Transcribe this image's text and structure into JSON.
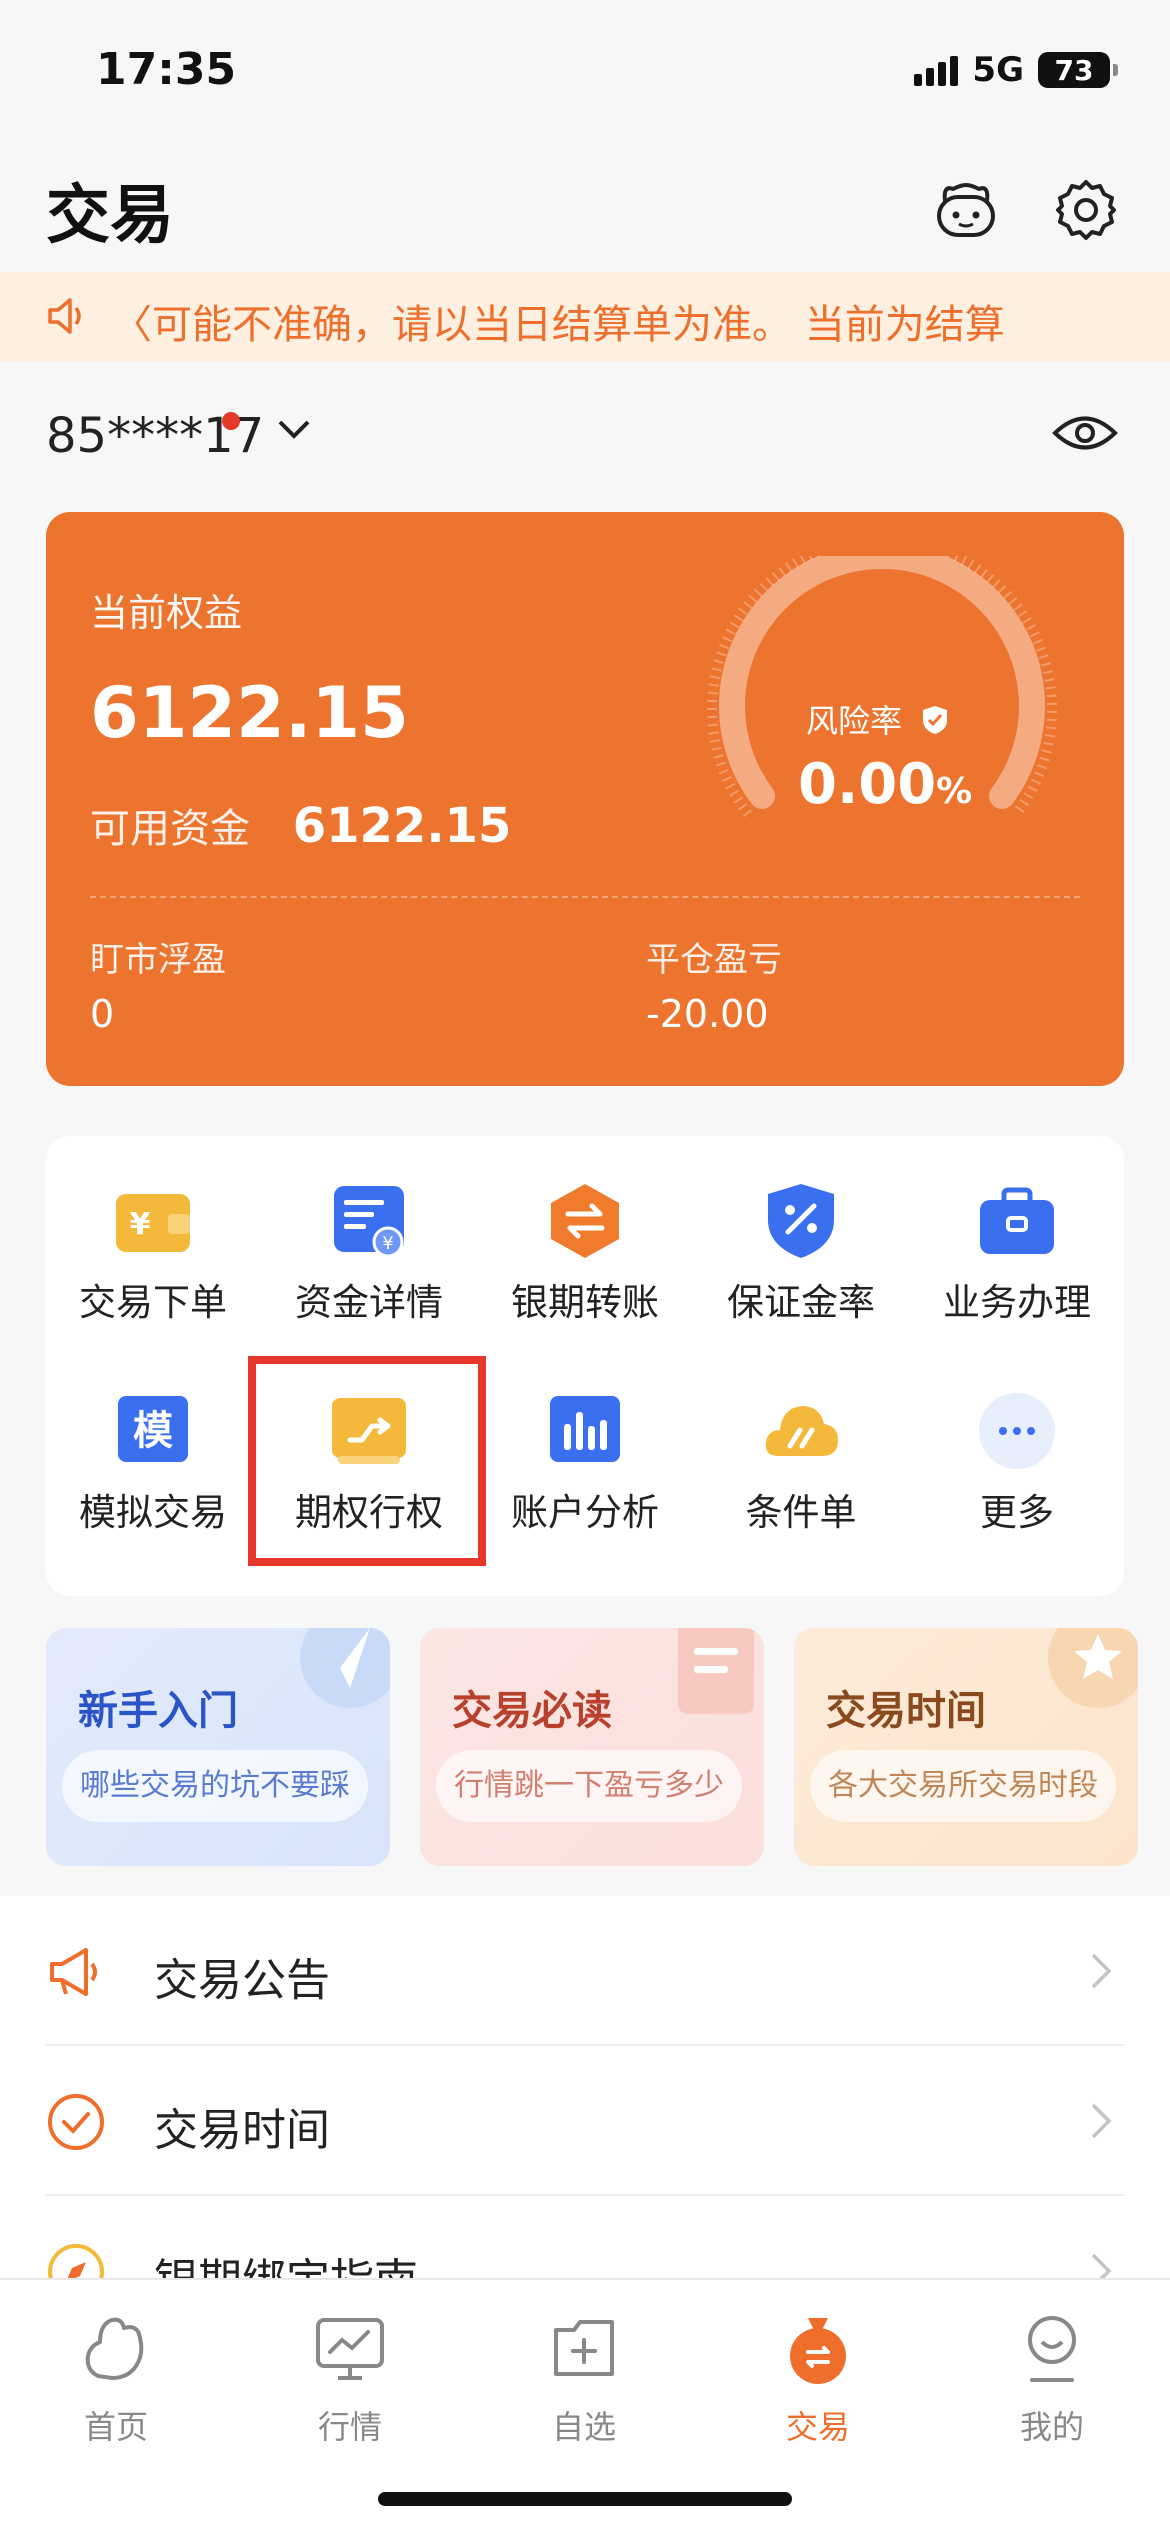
{
  "status_bar": {
    "time": "17:35",
    "network": "5G",
    "battery": "73"
  },
  "header": {
    "title": "交易"
  },
  "notice": {
    "text": "〈可能不准确，请以当日结算单为准。        当前为结算"
  },
  "account": {
    "number": "85****17"
  },
  "equity_card": {
    "equity_label": "当前权益",
    "equity_value": "6122.15",
    "available_label": "可用资金",
    "available_value": "6122.15",
    "risk_label": "风险率",
    "risk_value": "0.00",
    "risk_unit": "%",
    "floating_label": "盯市浮盈",
    "floating_value": "0",
    "closing_label": "平仓盈亏",
    "closing_value": "-20.00"
  },
  "grid": [
    {
      "label": "交易下单",
      "icon": "wallet-icon",
      "color": "#f4b83a"
    },
    {
      "label": "资金详情",
      "icon": "fund-detail-icon",
      "color": "#3a6ff0"
    },
    {
      "label": "银期转账",
      "icon": "transfer-icon",
      "color": "#f07b2c"
    },
    {
      "label": "保证金率",
      "icon": "margin-shield-icon",
      "color": "#3a6ff0"
    },
    {
      "label": "业务办理",
      "icon": "briefcase-icon",
      "color": "#3a6ff0"
    },
    {
      "label": "模拟交易",
      "icon": "simulate-icon",
      "glyph": "模",
      "color": "#3a6ff0"
    },
    {
      "label": "期权行权",
      "icon": "option-exercise-icon",
      "color": "#f4b83a"
    },
    {
      "label": "账户分析",
      "icon": "bar-chart-icon",
      "color": "#3a6ff0"
    },
    {
      "label": "条件单",
      "icon": "condition-order-icon",
      "color": "#f4b83a"
    },
    {
      "label": "更多",
      "icon": "more-icon",
      "color": "#3a6ff0"
    }
  ],
  "promos": [
    {
      "title": "新手入门",
      "subtitle": "哪些交易的坑不要踩",
      "color": "#2a55c8"
    },
    {
      "title": "交易必读",
      "subtitle": "行情跳一下盈亏多少",
      "color": "#b8402c"
    },
    {
      "title": "交易时间",
      "subtitle": "各大交易所交易时段",
      "color": "#8a4a1e"
    }
  ],
  "menu": [
    {
      "label": "交易公告",
      "icon": "megaphone-icon"
    },
    {
      "label": "交易时间",
      "icon": "check-circle-icon"
    },
    {
      "label": "银期绑定指南",
      "icon": "compass-icon"
    }
  ],
  "tabs": [
    {
      "label": "首页",
      "icon": "home-icon"
    },
    {
      "label": "行情",
      "icon": "market-icon"
    },
    {
      "label": "自选",
      "icon": "watchlist-icon"
    },
    {
      "label": "交易",
      "icon": "trade-bag-icon",
      "active": true
    },
    {
      "label": "我的",
      "icon": "profile-icon"
    }
  ],
  "colors": {
    "accent": "#ef6e2b",
    "card": "#ed742f",
    "highlight": "#e5382b"
  }
}
